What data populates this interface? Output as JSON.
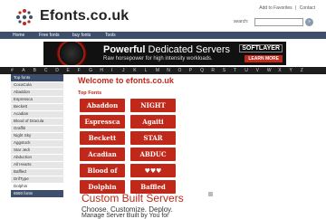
{
  "site": {
    "name": "Efonts.co.uk"
  },
  "toplinks": {
    "favorites": "Add to Favorites",
    "sep": "|",
    "contact": "Contact"
  },
  "search": {
    "label": "search:",
    "value": "",
    "button": "»"
  },
  "nav": [
    "Home",
    "Free fonts",
    "buy fonts",
    "Tools"
  ],
  "banner": {
    "headline_bold": "Powerful",
    "headline_rest": "Dedicated Servers",
    "subline": "Raw horsepower for high intensity workloads.",
    "brand": "SOFTLAYER",
    "cta": "LEARN MORE"
  },
  "alphabet": [
    "#",
    "A",
    "B",
    "C",
    "D",
    "E",
    "F",
    "G",
    "H",
    "I",
    "J",
    "K",
    "L",
    "M",
    "N",
    "O",
    "P",
    "Q",
    "R",
    "S",
    "T",
    "U",
    "V",
    "W",
    "X",
    "Y",
    "Z"
  ],
  "sidebar": {
    "header": "Top fonts",
    "items": [
      "CocaCola",
      "Abaddon",
      "Espressca",
      "Beckett",
      "Acadian",
      "Blood of Dracula",
      "Graffiti",
      "Night Sky",
      "Aggstock",
      "Star Jedi",
      "Abduction",
      "All Hearts",
      "Baffled",
      "DrifType",
      "Dolphin"
    ],
    "footer": "6550 fonts"
  },
  "main": {
    "welcome": "Welcome to efonts.co.uk",
    "top_fonts_label": "Top Fonts",
    "tiles": [
      "Abaddon",
      "NIGHT",
      "Espressca",
      "Agaiti",
      "Beckett",
      "STAR",
      "Acadian",
      "ABDUC",
      "Blood of",
      "♥♥♥",
      "Dolphin",
      "Baffled"
    ]
  },
  "ad": {
    "title": "Custom Built Servers",
    "line1": "Choose. Customize. Deploy.",
    "line2": "Manage Server Built by You for"
  },
  "colors": {
    "accent": "#c0281a",
    "nav": "#3d4f6b",
    "alphabar": "#1e1e1e",
    "sidebar": "#e6e6e6"
  }
}
